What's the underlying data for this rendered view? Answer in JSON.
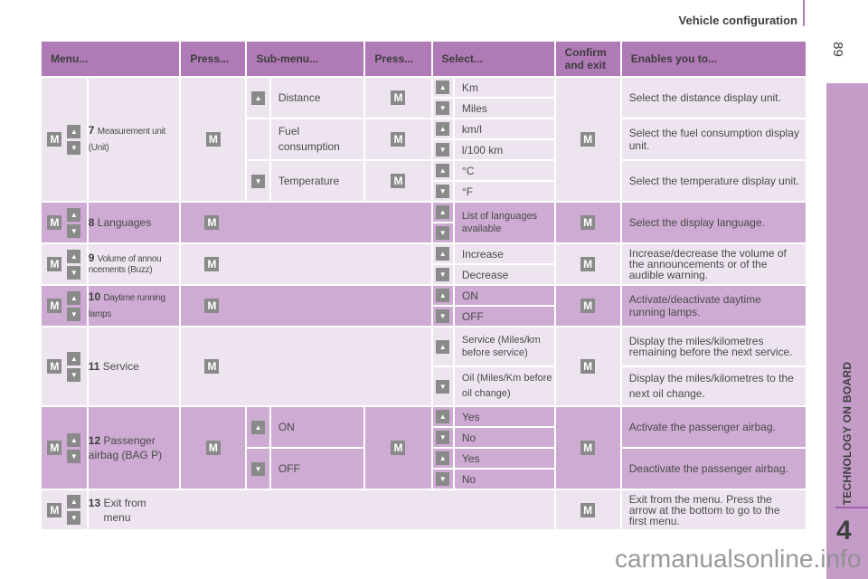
{
  "header": {
    "title": "Vehicle configuration",
    "page_number": "89"
  },
  "side_tab": {
    "label": "TECHNOLOGY ON BOARD",
    "chapter": "4"
  },
  "watermark": "carmanualsonline.info",
  "icons": {
    "menu_key": "M",
    "up": "▲",
    "down": "▼"
  },
  "colors": {
    "header": "#b07ab6",
    "row_light": "#ede4f0",
    "row_dark": "#cdabd2",
    "key_gray": "#8a8a8a",
    "side_tab": "#c39dc8"
  },
  "table": {
    "columns": [
      "Menu...",
      "Press...",
      "Sub-menu...",
      "Press...",
      "Select...",
      "Confirm and exit",
      "Enables you to..."
    ],
    "rows": [
      {
        "num": "7",
        "menu": "Measurement unit (Unit)",
        "submenus": [
          {
            "label": "Distance",
            "options": [
              "Km",
              "Miles"
            ],
            "description": "Select the distance display unit."
          },
          {
            "label": "Fuel consumption",
            "options": [
              "km/l",
              "l/100 km"
            ],
            "description": "Select the fuel consumption display unit."
          },
          {
            "label": "Temperature",
            "options": [
              "°C",
              "°F"
            ],
            "description": "Select the temperature display unit."
          }
        ]
      },
      {
        "num": "8",
        "menu": "Languages",
        "options": [
          "List of languages available"
        ],
        "description": "Select the display language."
      },
      {
        "num": "9",
        "menu": "Volume of annou ncements (Buzz)",
        "options": [
          "Increase",
          "Decrease"
        ],
        "description": "Increase/decrease the volume of the announcements or of the audible warning."
      },
      {
        "num": "10",
        "menu": "Daytime running lamps",
        "options": [
          "ON",
          "OFF"
        ],
        "description": "Activate/deactivate daytime running lamps."
      },
      {
        "num": "11",
        "menu": "Service",
        "options": [
          "Service (Miles/km before service)",
          "Oil (Miles/Km before oil change)"
        ],
        "descriptions": [
          "Display the miles/kilometres remaining before the next service.",
          "Display the miles/kilometres to the next oil change."
        ]
      },
      {
        "num": "12",
        "menu": "Passenger airbag (BAG P)",
        "submenus": [
          {
            "label": "ON",
            "options": [
              "Yes",
              "No"
            ],
            "description": "Activate the passenger airbag."
          },
          {
            "label": "OFF",
            "options": [
              "Yes",
              "No"
            ],
            "description": "Deactivate the passenger airbag."
          }
        ]
      },
      {
        "num": "13",
        "menu": "Exit from menu",
        "description": "Exit from the menu. Press the arrow at the bottom to go to the first menu."
      }
    ]
  }
}
